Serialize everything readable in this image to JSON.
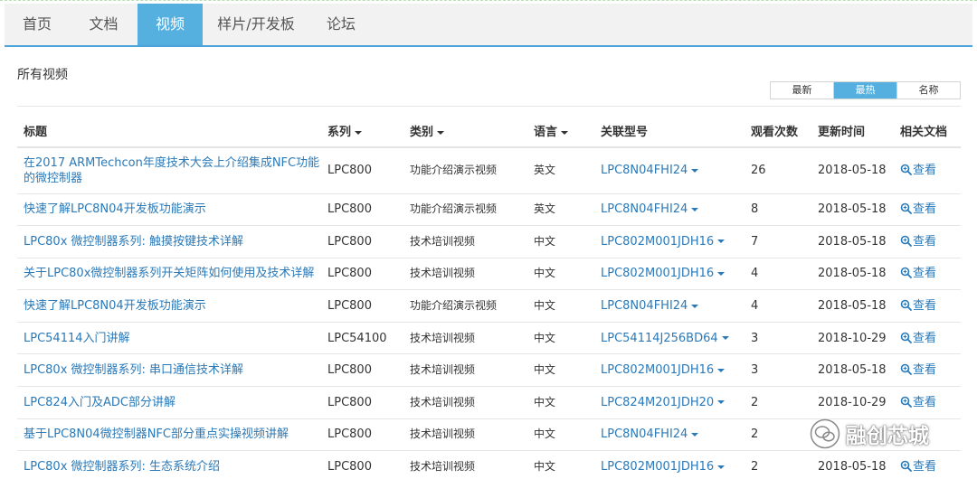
{
  "nav": {
    "tabs": [
      {
        "label": "首页",
        "active": false
      },
      {
        "label": "文档",
        "active": false
      },
      {
        "label": "视频",
        "active": true
      },
      {
        "label": "样片/开发板",
        "active": false
      },
      {
        "label": "论坛",
        "active": false
      }
    ]
  },
  "section_title": "所有视频",
  "sort": {
    "latest": "最新",
    "hottest": "最热",
    "name": "名称",
    "active": "hottest"
  },
  "table": {
    "headers": {
      "title": "标题",
      "series": "系列",
      "category": "类别",
      "language": "语言",
      "model": "关联型号",
      "views": "观看次数",
      "updated": "更新时间",
      "docs": "相关文档"
    },
    "rows": [
      {
        "title": "在2017 ARMTechcon年度技术大会上介绍集成NFC功能的微控制器",
        "series": "LPC800",
        "category": "功能介绍演示视频",
        "language": "英文",
        "model": "LPC8N04FHI24",
        "views": "26",
        "updated": "2018-05-18",
        "doc": "查看"
      },
      {
        "title": "快速了解LPC8N04开发板功能演示",
        "series": "LPC800",
        "category": "功能介绍演示视频",
        "language": "英文",
        "model": "LPC8N04FHI24",
        "views": "8",
        "updated": "2018-05-18",
        "doc": "查看"
      },
      {
        "title": "LPC80x 微控制器系列: 触摸按键技术详解",
        "series": "LPC800",
        "category": "技术培训视频",
        "language": "中文",
        "model": "LPC802M001JDH16",
        "views": "7",
        "updated": "2018-05-18",
        "doc": "查看"
      },
      {
        "title": "关于LPC80x微控制器系列开关矩阵如何使用及技术详解",
        "series": "LPC800",
        "category": "技术培训视频",
        "language": "中文",
        "model": "LPC802M001JDH16",
        "views": "4",
        "updated": "2018-05-18",
        "doc": "查看"
      },
      {
        "title": "快速了解LPC8N04开发板功能演示",
        "series": "LPC800",
        "category": "功能介绍演示视频",
        "language": "中文",
        "model": "LPC8N04FHI24",
        "views": "4",
        "updated": "2018-05-18",
        "doc": "查看"
      },
      {
        "title": "LPC54114入门讲解",
        "series": "LPC54100",
        "category": "技术培训视频",
        "language": "中文",
        "model": "LPC54114J256BD64",
        "views": "3",
        "updated": "2018-10-29",
        "doc": "查看"
      },
      {
        "title": "LPC80x 微控制器系列: 串口通信技术详解",
        "series": "LPC800",
        "category": "技术培训视频",
        "language": "中文",
        "model": "LPC802M001JDH16",
        "views": "3",
        "updated": "2018-05-18",
        "doc": "查看"
      },
      {
        "title": "LPC824入门及ADC部分讲解",
        "series": "LPC800",
        "category": "技术培训视频",
        "language": "中文",
        "model": "LPC824M201JDH20",
        "views": "2",
        "updated": "2018-10-29",
        "doc": "查看"
      },
      {
        "title": "基于LPC8N04微控制器NFC部分重点实操视频讲解",
        "series": "LPC800",
        "category": "技术培训视频",
        "language": "中文",
        "model": "LPC8N04FHI24",
        "views": "2",
        "updated": "",
        "doc": ""
      },
      {
        "title": "LPC80x 微控制器系列: 生态系统介绍",
        "series": "LPC800",
        "category": "技术培训视频",
        "language": "中文",
        "model": "LPC802M001JDH16",
        "views": "2",
        "updated": "2018-05-18",
        "doc": "查看"
      }
    ]
  },
  "watermark": {
    "text": "融创芯城",
    "icon": "wechat-icon"
  },
  "colors": {
    "accent": "#55b0e0",
    "link": "#2a79b8",
    "nav_bg": "#f2f2f2"
  }
}
